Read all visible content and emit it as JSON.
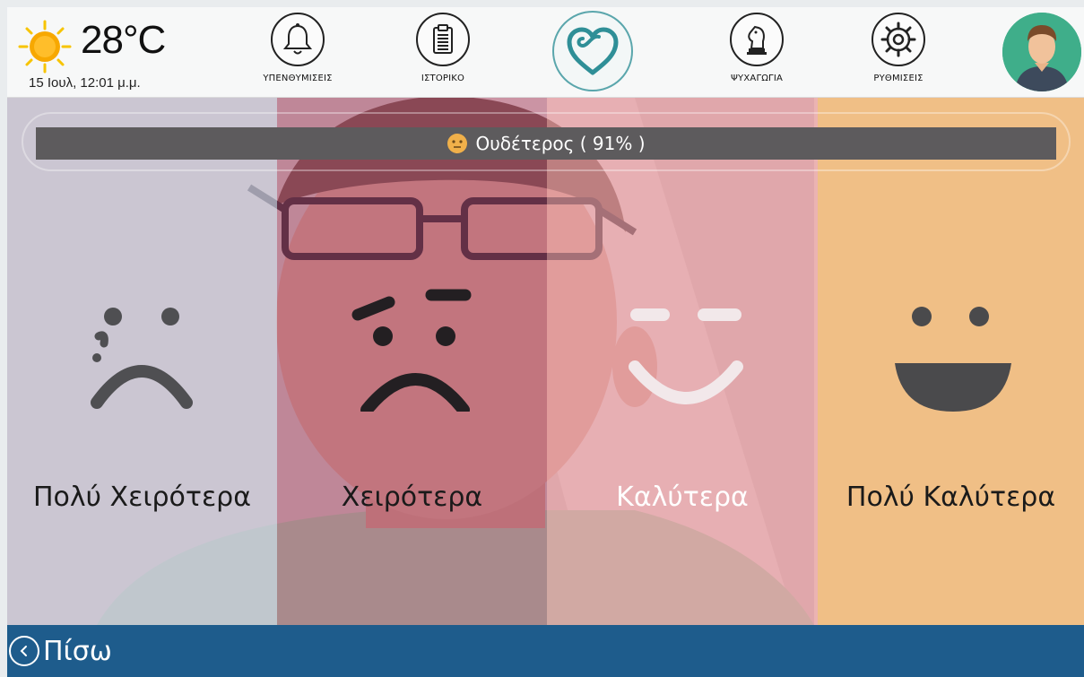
{
  "weather": {
    "temperature": "28°C",
    "datetime": "15 Ιουλ, 12:01 μ.μ.",
    "icon": "sun-icon",
    "sun_color": "#f7a800"
  },
  "nav": [
    {
      "label": "ΥΠΕΝΘΥΜΙΣΕΙΣ",
      "icon": "bell-icon"
    },
    {
      "label": "ΙΣΤΟΡΙΚΟ",
      "icon": "clipboard-icon"
    },
    {
      "label": "ΨΥΧΑΓΩΓΙΑ",
      "icon": "chess-knight-icon"
    },
    {
      "label": "ΡΥΘΜΙΣΕΙΣ",
      "icon": "gear-icon"
    }
  ],
  "center_icon": {
    "icon": "heart-icon",
    "color": "#2f8f97"
  },
  "avatar": {
    "icon": "user-avatar-icon",
    "bg_color": "#3fae8a"
  },
  "mood": {
    "text": "Ουδέτερος ( 91% )",
    "icon": "neutral-face-icon"
  },
  "options": [
    {
      "label": "Πολύ Χειρότερα",
      "icon": "crying-sad-face-icon",
      "text_color": "#1a1a1a"
    },
    {
      "label": "Χειρότερα",
      "icon": "angry-sad-face-icon",
      "text_color": "#1a1a1a"
    },
    {
      "label": "Καλύτερα",
      "icon": "smiling-face-icon",
      "text_color": "#ffffff"
    },
    {
      "label": "Πολύ Καλύτερα",
      "icon": "laughing-face-icon",
      "text_color": "#1a1a1a"
    }
  ],
  "footer": {
    "back_label": "Πίσω",
    "bg_color": "#1e5c8c"
  }
}
